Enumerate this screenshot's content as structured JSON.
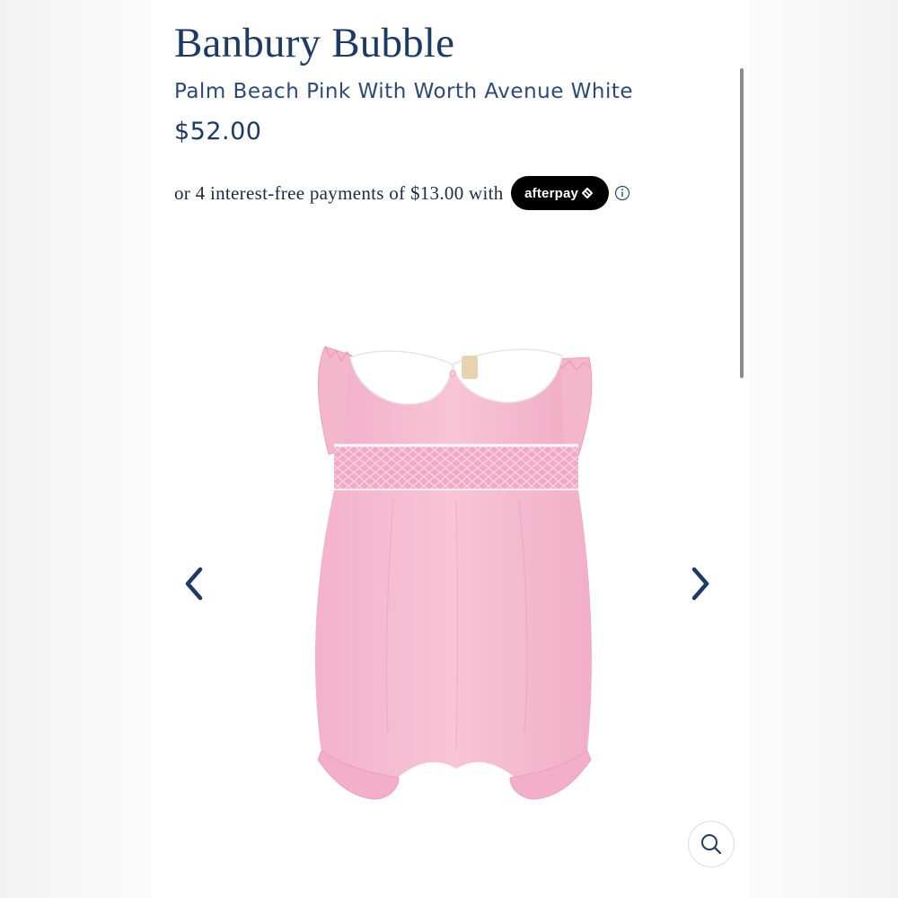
{
  "product": {
    "title": "Banbury Bubble",
    "variant": "Palm Beach Pink With Worth Avenue White",
    "price": "$52.00"
  },
  "afterpay": {
    "text": "or 4 interest-free payments of $13.00 with",
    "badge_label": "afterpay",
    "badge_icon": "afterpay-arrows-icon",
    "info_icon": "info-icon"
  },
  "gallery": {
    "image_subject": "pink smocked bubble romper with white collar",
    "prev_icon": "chevron-left-icon",
    "next_icon": "chevron-right-icon",
    "zoom_icon": "search-icon"
  },
  "colors": {
    "brand_navy": "#1b3a66",
    "garment_pink": "#f6bcd0",
    "collar_white": "#ffffff",
    "afterpay_badge": "#000000"
  }
}
